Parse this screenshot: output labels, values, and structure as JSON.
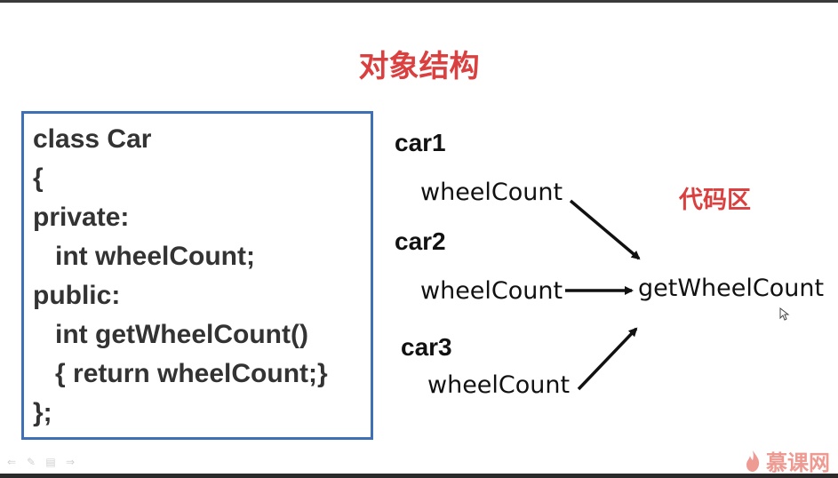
{
  "slide": {
    "title": "对象结构",
    "code_lines": [
      "class Car",
      "{",
      "private:",
      "   int wheelCount;",
      "public:",
      "   int getWheelCount()",
      "   { return wheelCount;}",
      "};"
    ],
    "objects": [
      {
        "name": "car1",
        "field": "wheelCount"
      },
      {
        "name": "car2",
        "field": "wheelCount"
      },
      {
        "name": "car3",
        "field": "wheelCount"
      }
    ],
    "code_region_label": "代码区",
    "method_label": "getWheelCount"
  },
  "player": {
    "nav_icons": [
      "prev-arrow-icon",
      "pen-icon",
      "menu-icon",
      "next-arrow-icon"
    ]
  },
  "watermark": {
    "brand_text": "慕课网",
    "brand_color": "#e04a3a"
  },
  "colors": {
    "title": "#d9403f",
    "box_border": "#3f6fb5"
  }
}
